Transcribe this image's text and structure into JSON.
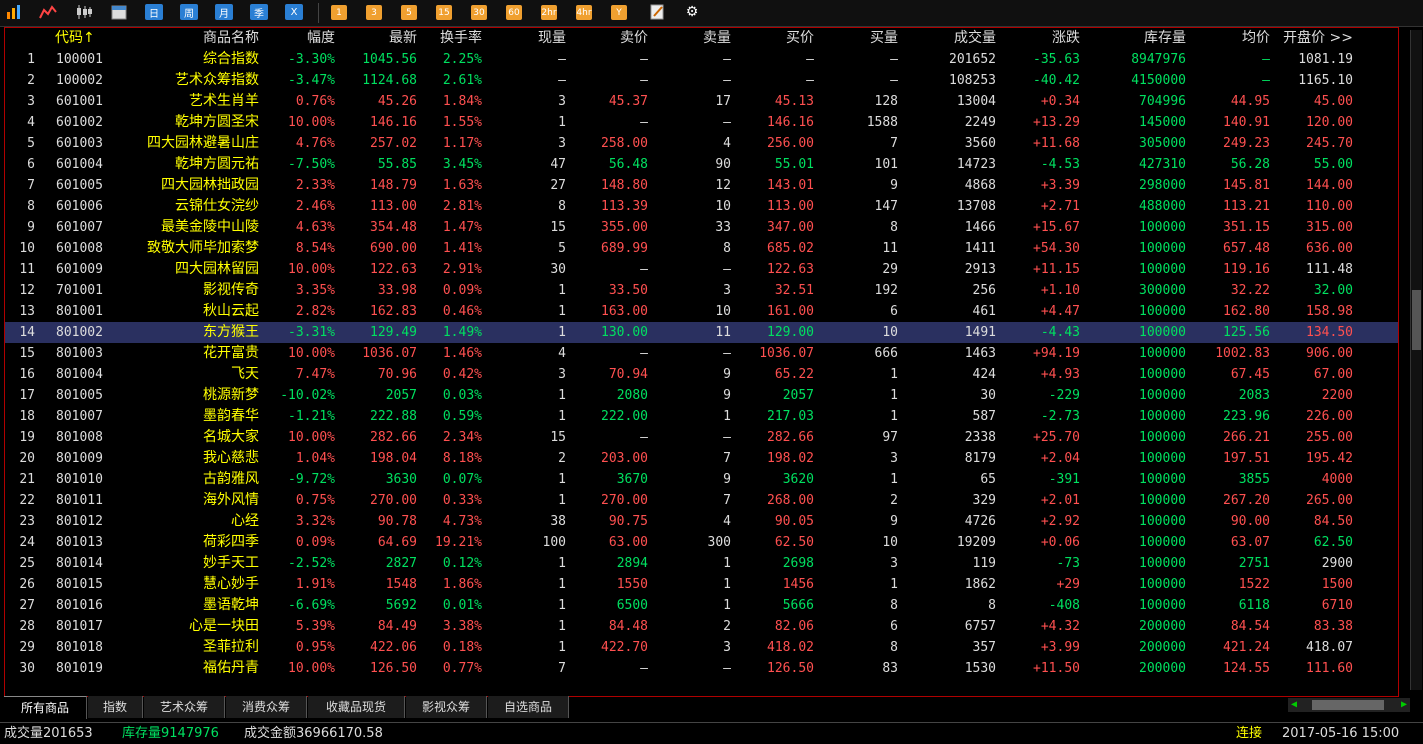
{
  "toolbar": {
    "icons": [
      "bar-chart-icon",
      "line-chart-icon",
      "candlestick-icon",
      "calendar-icon"
    ],
    "period_buttons": [
      "日",
      "周",
      "月",
      "季",
      "X"
    ],
    "minute_buttons": [
      "1",
      "3",
      "5",
      "15",
      "30",
      "60",
      "2hr",
      "4hr",
      "Y"
    ],
    "tool_icons": [
      "note-icon",
      "gear-icon"
    ]
  },
  "table": {
    "headers": [
      "代码↑",
      "商品名称",
      "幅度",
      "最新",
      "换手率",
      "现量",
      "卖价",
      "卖量",
      "买价",
      "买量",
      "成交量",
      "涨跌",
      "库存量",
      "均价",
      "开盘价 >>"
    ],
    "rows": [
      [
        "1",
        "100001",
        "综合指数",
        "-3.30%",
        "1045.56",
        "2.25%",
        "—",
        "—",
        "—",
        "—",
        "—",
        "201652",
        "-35.63",
        "8947976",
        "—",
        "1081.19"
      ],
      [
        "2",
        "100002",
        "艺术众筹指数",
        "-3.47%",
        "1124.68",
        "2.61%",
        "—",
        "—",
        "—",
        "—",
        "—",
        "108253",
        "-40.42",
        "4150000",
        "—",
        "1165.10"
      ],
      [
        "3",
        "601001",
        "艺术生肖羊",
        "0.76%",
        "45.26",
        "1.84%",
        "3",
        "45.37",
        "17",
        "45.13",
        "128",
        "13004",
        "+0.34",
        "704996",
        "44.95",
        "45.00"
      ],
      [
        "4",
        "601002",
        "乾坤方圆圣宋",
        "10.00%",
        "146.16",
        "1.55%",
        "1",
        "—",
        "—",
        "146.16",
        "1588",
        "2249",
        "+13.29",
        "145000",
        "140.91",
        "120.00"
      ],
      [
        "5",
        "601003",
        "四大园林避暑山庄",
        "4.76%",
        "257.02",
        "1.17%",
        "3",
        "258.00",
        "4",
        "256.00",
        "7",
        "3560",
        "+11.68",
        "305000",
        "249.23",
        "245.70"
      ],
      [
        "6",
        "601004",
        "乾坤方圆元祐",
        "-7.50%",
        "55.85",
        "3.45%",
        "47",
        "56.48",
        "90",
        "55.01",
        "101",
        "14723",
        "-4.53",
        "427310",
        "56.28",
        "55.00"
      ],
      [
        "7",
        "601005",
        "四大园林拙政园",
        "2.33%",
        "148.79",
        "1.63%",
        "27",
        "148.80",
        "12",
        "143.01",
        "9",
        "4868",
        "+3.39",
        "298000",
        "145.81",
        "144.00"
      ],
      [
        "8",
        "601006",
        "云锦仕女浣纱",
        "2.46%",
        "113.00",
        "2.81%",
        "8",
        "113.39",
        "10",
        "113.00",
        "147",
        "13708",
        "+2.71",
        "488000",
        "113.21",
        "110.00"
      ],
      [
        "9",
        "601007",
        "最美金陵中山陵",
        "4.63%",
        "354.48",
        "1.47%",
        "15",
        "355.00",
        "33",
        "347.00",
        "8",
        "1466",
        "+15.67",
        "100000",
        "351.15",
        "315.00"
      ],
      [
        "10",
        "601008",
        "致敬大师毕加索梦",
        "8.54%",
        "690.00",
        "1.41%",
        "5",
        "689.99",
        "8",
        "685.02",
        "11",
        "1411",
        "+54.30",
        "100000",
        "657.48",
        "636.00"
      ],
      [
        "11",
        "601009",
        "四大园林留园",
        "10.00%",
        "122.63",
        "2.91%",
        "30",
        "—",
        "—",
        "122.63",
        "29",
        "2913",
        "+11.15",
        "100000",
        "119.16",
        "111.48"
      ],
      [
        "12",
        "701001",
        "影视传奇",
        "3.35%",
        "33.98",
        "0.09%",
        "1",
        "33.50",
        "3",
        "32.51",
        "192",
        "256",
        "+1.10",
        "300000",
        "32.22",
        "32.00"
      ],
      [
        "13",
        "801001",
        "秋山云起",
        "2.82%",
        "162.83",
        "0.46%",
        "1",
        "163.00",
        "10",
        "161.00",
        "6",
        "461",
        "+4.47",
        "100000",
        "162.80",
        "158.98"
      ],
      [
        "14",
        "801002",
        "东方猴王",
        "-3.31%",
        "129.49",
        "1.49%",
        "1",
        "130.00",
        "11",
        "129.00",
        "10",
        "1491",
        "-4.43",
        "100000",
        "125.56",
        "134.50"
      ],
      [
        "15",
        "801003",
        "花开富贵",
        "10.00%",
        "1036.07",
        "1.46%",
        "4",
        "—",
        "—",
        "1036.07",
        "666",
        "1463",
        "+94.19",
        "100000",
        "1002.83",
        "906.00"
      ],
      [
        "16",
        "801004",
        "飞天",
        "7.47%",
        "70.96",
        "0.42%",
        "3",
        "70.94",
        "9",
        "65.22",
        "1",
        "424",
        "+4.93",
        "100000",
        "67.45",
        "67.00"
      ],
      [
        "17",
        "801005",
        "桃源新梦",
        "-10.02%",
        "2057",
        "0.03%",
        "1",
        "2080",
        "9",
        "2057",
        "1",
        "30",
        "-229",
        "100000",
        "2083",
        "2200"
      ],
      [
        "18",
        "801007",
        "墨韵春华",
        "-1.21%",
        "222.88",
        "0.59%",
        "1",
        "222.00",
        "1",
        "217.03",
        "1",
        "587",
        "-2.73",
        "100000",
        "223.96",
        "226.00"
      ],
      [
        "19",
        "801008",
        "名城大家",
        "10.00%",
        "282.66",
        "2.34%",
        "15",
        "—",
        "—",
        "282.66",
        "97",
        "2338",
        "+25.70",
        "100000",
        "266.21",
        "255.00"
      ],
      [
        "20",
        "801009",
        "我心慈悲",
        "1.04%",
        "198.04",
        "8.18%",
        "2",
        "203.00",
        "7",
        "198.02",
        "3",
        "8179",
        "+2.04",
        "100000",
        "197.51",
        "195.42"
      ],
      [
        "21",
        "801010",
        "古韵雅风",
        "-9.72%",
        "3630",
        "0.07%",
        "1",
        "3670",
        "9",
        "3620",
        "1",
        "65",
        "-391",
        "100000",
        "3855",
        "4000"
      ],
      [
        "22",
        "801011",
        "海外风情",
        "0.75%",
        "270.00",
        "0.33%",
        "1",
        "270.00",
        "7",
        "268.00",
        "2",
        "329",
        "+2.01",
        "100000",
        "267.20",
        "265.00"
      ],
      [
        "23",
        "801012",
        "心经",
        "3.32%",
        "90.78",
        "4.73%",
        "38",
        "90.75",
        "4",
        "90.05",
        "9",
        "4726",
        "+2.92",
        "100000",
        "90.00",
        "84.50"
      ],
      [
        "24",
        "801013",
        "荷彩四季",
        "0.09%",
        "64.69",
        "19.21%",
        "100",
        "63.00",
        "300",
        "62.50",
        "10",
        "19209",
        "+0.06",
        "100000",
        "63.07",
        "62.50"
      ],
      [
        "25",
        "801014",
        "妙手天工",
        "-2.52%",
        "2827",
        "0.12%",
        "1",
        "2894",
        "1",
        "2698",
        "3",
        "119",
        "-73",
        "100000",
        "2751",
        "2900"
      ],
      [
        "26",
        "801015",
        "慧心妙手",
        "1.91%",
        "1548",
        "1.86%",
        "1",
        "1550",
        "1",
        "1456",
        "1",
        "1862",
        "+29",
        "100000",
        "1522",
        "1500"
      ],
      [
        "27",
        "801016",
        "墨语乾坤",
        "-6.69%",
        "5692",
        "0.01%",
        "1",
        "6500",
        "1",
        "5666",
        "8",
        "8",
        "-408",
        "100000",
        "6118",
        "6710"
      ],
      [
        "28",
        "801017",
        "心是一块田",
        "5.39%",
        "84.49",
        "3.38%",
        "1",
        "84.48",
        "2",
        "82.06",
        "6",
        "6757",
        "+4.32",
        "200000",
        "84.54",
        "83.38"
      ],
      [
        "29",
        "801018",
        "圣菲拉利",
        "0.95%",
        "422.06",
        "0.18%",
        "1",
        "422.70",
        "3",
        "418.02",
        "8",
        "357",
        "+3.99",
        "200000",
        "421.24",
        "418.07"
      ],
      [
        "30",
        "801019",
        "福佑丹青",
        "10.00%",
        "126.50",
        "0.77%",
        "7",
        "—",
        "—",
        "126.50",
        "83",
        "1530",
        "+11.50",
        "200000",
        "124.55",
        "111.60"
      ]
    ],
    "selected_row": 14
  },
  "tabs": [
    "所有商品",
    "指数",
    "艺术众筹",
    "消费众筹",
    "收藏品现货",
    "影视众筹",
    "自选商品"
  ],
  "status": {
    "volume": "成交量201653",
    "stock": "库存量9147976",
    "amount": "成交金额36966170.58",
    "connection": "连接",
    "datetime": "2017-05-16 15:00"
  },
  "colors": {
    "up": "#ff5050",
    "down": "#00e060",
    "name": "#ffff00",
    "border": "#b00000",
    "selected": "#2a3060"
  }
}
